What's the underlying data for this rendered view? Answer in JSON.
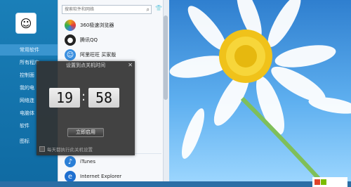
{
  "left_nav": {
    "items": [
      "常用软件",
      "所有程序",
      "控制面",
      "我的电",
      "网络连",
      "电脑体",
      "软件",
      "图标"
    ],
    "active_index": 0
  },
  "search": {
    "placeholder": "搜索软件和网络",
    "value": ""
  },
  "apps": [
    {
      "label": "360极速浏览器",
      "icon": "360-browser-icon",
      "color": "#f0a21a"
    },
    {
      "label": "腾讯QQ",
      "icon": "qq-penguin-icon",
      "color": "#111111"
    },
    {
      "label": "阿里旺旺 买家版",
      "icon": "wangwang-icon",
      "color": "#ff8a00"
    },
    {
      "label": "iTunes",
      "icon": "itunes-icon",
      "color": "#2b7fd6"
    },
    {
      "label": "Internet Explorer",
      "icon": "ie-icon",
      "color": "#1e6fd0"
    }
  ],
  "dialog": {
    "title": "设置到点关机时间",
    "hour": "19",
    "minute": "58",
    "confirm_label": "立即启用",
    "daily_label": "每天都执行此关机设置"
  },
  "colors": {
    "nav_bg": "#1a7fb8",
    "dialog_bg": "#323232",
    "accent": "#3a95cf"
  }
}
